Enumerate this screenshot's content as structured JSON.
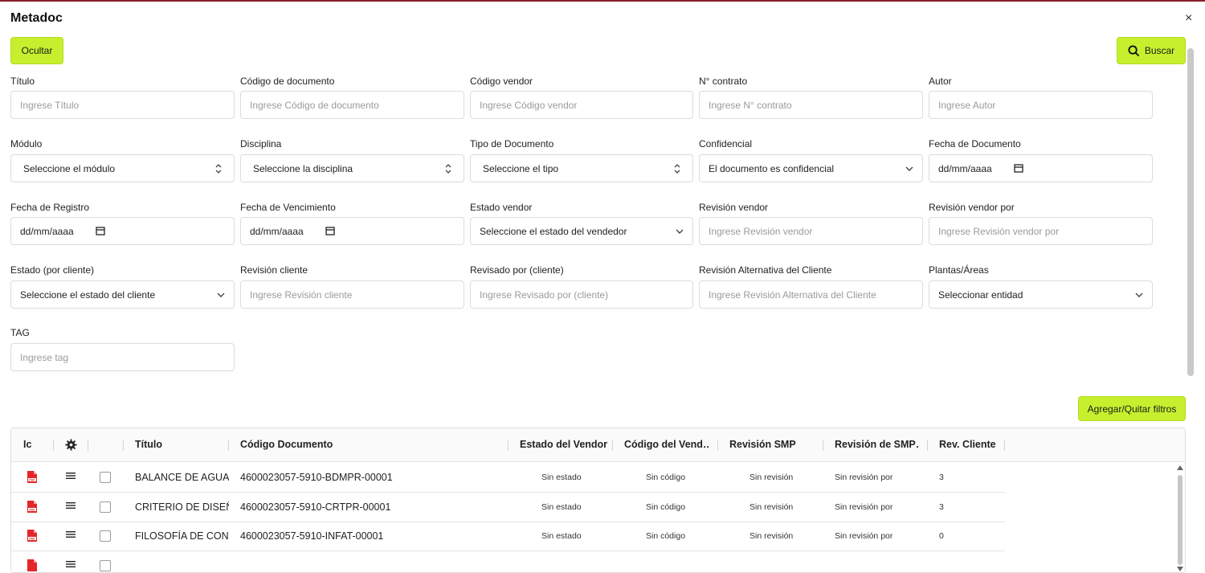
{
  "modal": {
    "title": "Metadoc",
    "close_glyph": "×"
  },
  "buttons": {
    "ocultar": "Ocultar",
    "buscar": "Buscar",
    "filtros": "Agregar/Quitar filtros"
  },
  "fields": {
    "titulo": {
      "label": "Título",
      "placeholder": "Ingrese Título"
    },
    "codigo_documento": {
      "label": "Código de documento",
      "placeholder": "Ingrese Código de documento"
    },
    "codigo_vendor": {
      "label": "Código vendor",
      "placeholder": "Ingrese Código vendor"
    },
    "n_contrato": {
      "label": "N° contrato",
      "placeholder": "Ingrese N° contrato"
    },
    "autor": {
      "label": "Autor",
      "placeholder": "Ingrese Autor"
    },
    "modulo": {
      "label": "Módulo",
      "value": "Seleccione el módulo"
    },
    "disciplina": {
      "label": "Disciplina",
      "value": "Seleccione la disciplina"
    },
    "tipo_documento": {
      "label": "Tipo de Documento",
      "value": "Seleccione el tipo"
    },
    "confidencial": {
      "label": "Confidencial",
      "value": "El documento es confidencial"
    },
    "fecha_documento": {
      "label": "Fecha de Documento",
      "value": "dd/mm/aaaa"
    },
    "fecha_registro": {
      "label": "Fecha de Registro",
      "value": "dd/mm/aaaa"
    },
    "fecha_vencimiento": {
      "label": "Fecha de Vencimiento",
      "value": "dd/mm/aaaa"
    },
    "estado_vendor": {
      "label": "Estado vendor",
      "value": "Seleccione el estado del vendedor"
    },
    "revision_vendor": {
      "label": "Revisión vendor",
      "placeholder": "Ingrese Revisión vendor"
    },
    "revision_vendor_por": {
      "label": "Revisión vendor por",
      "placeholder": "Ingrese Revisión vendor por"
    },
    "estado_cliente": {
      "label": "Estado (por cliente)",
      "value": "Seleccione el estado del cliente"
    },
    "revision_cliente": {
      "label": "Revisión cliente",
      "placeholder": "Ingrese Revisión cliente"
    },
    "revisado_por_cliente": {
      "label": "Revisado por (cliente)",
      "placeholder": "Ingrese Revisado por (cliente)"
    },
    "revision_alternativa": {
      "label": "Revisión Alternativa del Cliente",
      "placeholder": "Ingrese Revisión Alternativa del Cliente"
    },
    "plantas_areas": {
      "label": "Plantas/Áreas",
      "value": "Seleccionar entidad"
    },
    "tag": {
      "label": "TAG",
      "placeholder": "Ingrese tag"
    }
  },
  "table": {
    "headers": [
      "Ic",
      "Título",
      "Código Documento",
      "Estado del Vendor",
      "Código del Vend…",
      "Revisión SMP",
      "Revisión de SMP…",
      "Rev. Cliente"
    ],
    "rows": [
      {
        "titulo": "BALANCE DE AGUA A",
        "codigo": "4600023057-5910-BDMPR-00001",
        "estado_vendor": "Sin estado",
        "codigo_vendor": "Sin código",
        "revision_smp": "Sin revisión",
        "revision_smp_por": "Sin revisión por",
        "rev_cliente": "3"
      },
      {
        "titulo": "CRITERIO DE DISEÑO",
        "codigo": "4600023057-5910-CRTPR-00001",
        "estado_vendor": "Sin estado",
        "codigo_vendor": "Sin código",
        "revision_smp": "Sin revisión",
        "revision_smp_por": "Sin revisión por",
        "rev_cliente": "3"
      },
      {
        "titulo": "FILOSOFÍA DE CONTR",
        "codigo": "4600023057-5910-INFAT-00001",
        "estado_vendor": "Sin estado",
        "codigo_vendor": "Sin código",
        "revision_smp": "Sin revisión",
        "revision_smp_por": "Sin revisión por",
        "rev_cliente": "0"
      },
      {
        "titulo": "",
        "codigo": "",
        "estado_vendor": "",
        "codigo_vendor": "",
        "revision_smp": "",
        "revision_smp_por": "",
        "rev_cliente": ""
      }
    ]
  },
  "colors": {
    "accent": "#c6f02e",
    "pdf_red": "#e3262a",
    "border": "#dcdcdc"
  }
}
